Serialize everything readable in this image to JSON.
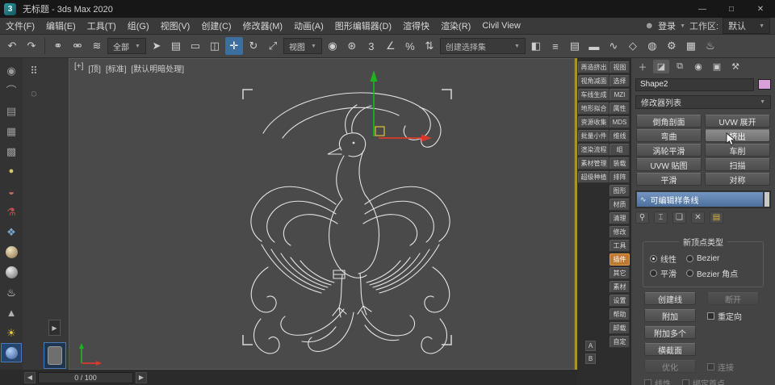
{
  "colors": {
    "accent_blue": "#3d6f9e",
    "stack_selected_top": "#7396c2",
    "stack_selected_bottom": "#4d6f9b",
    "highlight_orange": "#c07830",
    "gizmo_green": "#1db51d",
    "gizmo_red": "#d83a2a",
    "gizmo_yellow": "#d8c23a",
    "object_color_swatch": "#d8a0d8",
    "viewport_border_yellow": "#a8922e",
    "wireframe_white": "#e2e2e2"
  },
  "titlebar": {
    "logo_glyph": "3",
    "title": "无标题 - 3ds Max 2020",
    "minimize": "—",
    "maximize": "□",
    "close": "✕"
  },
  "menubar": {
    "items": [
      {
        "name": "menu-file",
        "label": "文件(F)"
      },
      {
        "name": "menu-edit",
        "label": "编辑(E)"
      },
      {
        "name": "menu-tools",
        "label": "工具(T)"
      },
      {
        "name": "menu-group",
        "label": "组(G)"
      },
      {
        "name": "menu-views",
        "label": "视图(V)"
      },
      {
        "name": "menu-create",
        "label": "创建(C)"
      },
      {
        "name": "menu-modifiers",
        "label": "修改器(M)"
      },
      {
        "name": "menu-animation",
        "label": "动画(A)"
      },
      {
        "name": "menu-graph-editors",
        "label": "图形编辑器(D)"
      },
      {
        "name": "menu-xuandekuai",
        "label": "渲得快"
      },
      {
        "name": "menu-rendering",
        "label": "渲染(R)"
      },
      {
        "name": "menu-civil-view",
        "label": "Civil View"
      }
    ],
    "user_glyph": "☻",
    "login_label": "登录",
    "caret": "▼",
    "workspace_label": "工作区:",
    "workspace_value": "默认"
  },
  "toolbar": {
    "caret": "▼",
    "g1": [
      {
        "name": "undo-icon",
        "glyph": "↶"
      },
      {
        "name": "redo-icon",
        "glyph": "↷"
      }
    ],
    "g2": [
      {
        "name": "select-and-link-icon",
        "glyph": "⚭"
      },
      {
        "name": "unlink-selection-icon",
        "glyph": "⚮"
      },
      {
        "name": "bind-to-space-warp-icon",
        "glyph": "≋"
      }
    ],
    "filter_label": "全部",
    "g3": [
      {
        "name": "select-object-icon",
        "glyph": "➤"
      },
      {
        "name": "select-by-name-icon",
        "glyph": "▤"
      },
      {
        "name": "rectangular-selection-region-icon",
        "glyph": "▭"
      },
      {
        "name": "window-crossing-toggle-icon",
        "glyph": "◫"
      },
      {
        "name": "select-and-move-icon",
        "glyph": "✛",
        "cls": "active"
      },
      {
        "name": "select-and-rotate-icon",
        "glyph": "↻"
      },
      {
        "name": "select-and-scale-icon",
        "glyph": "⤢"
      }
    ],
    "coord_label": "视图",
    "g4": [
      {
        "name": "use-pivot-point-icon",
        "glyph": "◉"
      },
      {
        "name": "select-and-manipulate-icon",
        "glyph": "⊛"
      },
      {
        "name": "snap-toggle-icon",
        "glyph": "3"
      },
      {
        "name": "angle-snap-icon",
        "glyph": "∠"
      },
      {
        "name": "percent-snap-icon",
        "glyph": "%"
      },
      {
        "name": "spinner-snap-icon",
        "glyph": "⇅"
      }
    ],
    "selection_set_label": "创建选择集",
    "g5": [
      {
        "name": "mirror-icon",
        "glyph": "◧"
      },
      {
        "name": "align-icon",
        "glyph": "≡"
      },
      {
        "name": "layer-explorer-icon",
        "glyph": "▤"
      },
      {
        "name": "ribbon-icon",
        "glyph": "▬"
      },
      {
        "name": "curve-editor-icon",
        "glyph": "∿"
      },
      {
        "name": "schematic-view-icon",
        "glyph": "◇"
      },
      {
        "name": "material-editor-icon",
        "glyph": "◍"
      },
      {
        "name": "render-setup-icon",
        "glyph": "⚙"
      },
      {
        "name": "rendered-frame-window-icon",
        "glyph": "▦"
      },
      {
        "name": "render-production-icon",
        "glyph": "♨"
      }
    ]
  },
  "leftdock": {
    "items": [
      {
        "name": "eye-icon",
        "glyph": "◉",
        "style": "color:#9a9a9a"
      },
      {
        "name": "arc-icon",
        "glyph": "⌒",
        "style": "color:#9a9a9a"
      },
      {
        "name": "layers-icon",
        "glyph": "▤",
        "style": "color:#9a9a9a"
      },
      {
        "name": "spreadsheet-icon",
        "glyph": "▦",
        "style": "color:#9a9a9a"
      },
      {
        "name": "grid-icon",
        "glyph": "▩",
        "style": "color:#9a9a9a"
      },
      {
        "name": "bulb-icon",
        "glyph": "●",
        "style": "color:#d8c860;font-size:11px"
      },
      {
        "name": "magnet-icon",
        "glyph": "◒",
        "style": "color:#c87060"
      },
      {
        "name": "flask-icon",
        "glyph": "⚗",
        "style": "color:#c05050"
      },
      {
        "name": "palette-icon",
        "glyph": "❖",
        "style": "color:#7aa8d0"
      },
      {
        "name": "sphere-tan-icon",
        "cls": "ball",
        "style": "background:radial-gradient(circle at 35% 30%,#f2e4c2,#8a7048)"
      },
      {
        "name": "sphere-gray-icon",
        "cls": "ball",
        "style": "background:radial-gradient(circle at 35% 30%,#ececec,#6c6c6c)"
      },
      {
        "name": "teapot-icon",
        "glyph": "♨",
        "style": "color:#e6e6e6"
      },
      {
        "name": "cone-icon",
        "glyph": "▲",
        "style": "color:#b0b0b0"
      },
      {
        "name": "sun-icon",
        "glyph": "☀",
        "style": "color:#ecc83c"
      },
      {
        "name": "sphere-blue-icon",
        "cls": "ball pressed",
        "style": "background:radial-gradient(circle at 35% 30%,#b0d0f4,#3c5c9c)"
      }
    ]
  },
  "dock2": {
    "grid_glyph": "⠿",
    "circle_glyph": "◌",
    "expand_glyph": "▶"
  },
  "viewport": {
    "labels": [
      {
        "name": "viewport-menu-general",
        "label": "[+]"
      },
      {
        "name": "viewport-menu-pov",
        "label": "[顶]"
      },
      {
        "name": "viewport-menu-standard",
        "label": "[标准]"
      },
      {
        "name": "viewport-menu-shading",
        "label": "[默认明暗处理]"
      }
    ]
  },
  "scriptpanel": {
    "tools": [
      {
        "label": "再造挤出"
      },
      {
        "label": "视角减面"
      },
      {
        "label": "车线生成"
      },
      {
        "label": "地形拟合"
      },
      {
        "label": "资源收集"
      },
      {
        "label": "批量小件"
      },
      {
        "label": "渲染流程"
      },
      {
        "label": "素材管理"
      },
      {
        "label": "超级种植"
      }
    ],
    "categories": [
      {
        "label": "视图"
      },
      {
        "label": "选择"
      },
      {
        "label": "MZI"
      },
      {
        "label": "属性"
      },
      {
        "label": "MDS"
      },
      {
        "label": "维线"
      },
      {
        "label": "组"
      },
      {
        "label": "装载"
      },
      {
        "label": "排阵"
      },
      {
        "label": "图形"
      },
      {
        "label": "材质"
      },
      {
        "label": "清理"
      },
      {
        "label": "修改"
      },
      {
        "label": "工具"
      },
      {
        "label": "插件",
        "cls": "cat-active"
      },
      {
        "label": "其它"
      },
      {
        "label": "素材"
      },
      {
        "label": "设置"
      },
      {
        "label": "帮助"
      },
      {
        "label": "卸载"
      },
      {
        "label": "自定"
      }
    ],
    "a": "A",
    "b": "B"
  },
  "commandpanel": {
    "caret": "▼",
    "tabs": [
      {
        "name": "create-tab-icon",
        "glyph": "＋"
      },
      {
        "name": "modify-tab-icon",
        "glyph": "◪",
        "cls": "active"
      },
      {
        "name": "hierarchy-tab-icon",
        "glyph": "⧉"
      },
      {
        "name": "motion-tab-icon",
        "glyph": "◉"
      },
      {
        "name": "display-tab-icon",
        "glyph": "▣"
      },
      {
        "name": "utilities-tab-icon",
        "glyph": "⚒"
      }
    ],
    "object_name": "Shape2",
    "modifier_list_label": "修改器列表",
    "modifier_buttons": [
      {
        "label": "倒角剖面"
      },
      {
        "label": "UVW 展开"
      },
      {
        "label": "弯曲"
      },
      {
        "label": "挤出",
        "cls": "hl"
      },
      {
        "label": "涡轮平滑"
      },
      {
        "label": "车削"
      },
      {
        "label": "UVW 贴图"
      },
      {
        "label": "扫描"
      },
      {
        "label": "平滑"
      },
      {
        "label": "对称"
      }
    ],
    "stack_icon": "∿",
    "stack_item": "可编辑样条线",
    "stack_tools": [
      {
        "name": "pin-stack-icon",
        "glyph": "⚲"
      },
      {
        "name": "show-end-result-icon",
        "glyph": "⌶"
      },
      {
        "name": "make-unique-icon",
        "glyph": "❏"
      },
      {
        "name": "remove-modifier-icon",
        "glyph": "✕"
      },
      {
        "name": "configure-modifier-sets-icon",
        "glyph": "▤",
        "style": "color:#d8b23a"
      }
    ],
    "group_title": "新顶点类型",
    "radios": [
      "线性",
      "Bezier",
      "平滑",
      "Bezier 角点"
    ],
    "buttons": {
      "create_line": "创建线",
      "break_btn": "断开",
      "attach": "附加",
      "reorient": "重定向",
      "attach_multiple": "附加多个",
      "cross_section": "横截面",
      "refine": "优化",
      "connect": "连接",
      "linear": "线性",
      "bind_first": "绑定首点"
    }
  },
  "timeline": {
    "prev": "◀",
    "next": "▶",
    "value": "0 / 100"
  }
}
